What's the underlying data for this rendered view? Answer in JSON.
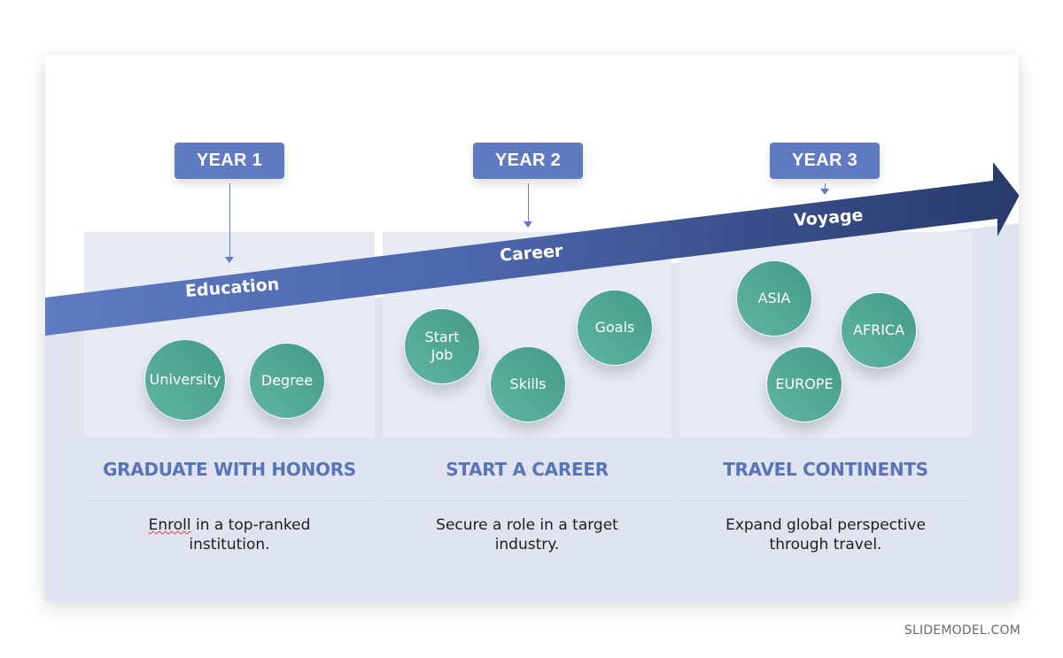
{
  "timeline": {
    "years": [
      "YEAR 1",
      "YEAR 2",
      "YEAR 3"
    ],
    "arrow_labels": [
      "Education",
      "Career",
      "Voyage"
    ],
    "colors": {
      "box": "#5f7ac0",
      "arrow_start": "#5f7ac0",
      "arrow_end": "#283a6b",
      "bubble": "#52a891",
      "heading": "#5a74b8",
      "panel": "#e8ebf3",
      "band": "#dfe4f0"
    }
  },
  "sections": [
    {
      "bubbles": [
        "University",
        "Degree"
      ],
      "heading": "GRADUATE WITH HONORS",
      "desc_word1": "Enroll",
      "desc_rest": " in a top-ranked institution."
    },
    {
      "bubbles": [
        "Start Job",
        "Skills",
        "Goals"
      ],
      "heading": "START A CAREER",
      "desc_rest": "Secure a role in a target industry."
    },
    {
      "bubbles": [
        "ASIA",
        "AFRICA",
        "EUROPE"
      ],
      "heading": "TRAVEL CONTINENTS",
      "desc_rest": "Expand global perspective through travel."
    }
  ],
  "watermark": "SLIDEMODEL.COM"
}
